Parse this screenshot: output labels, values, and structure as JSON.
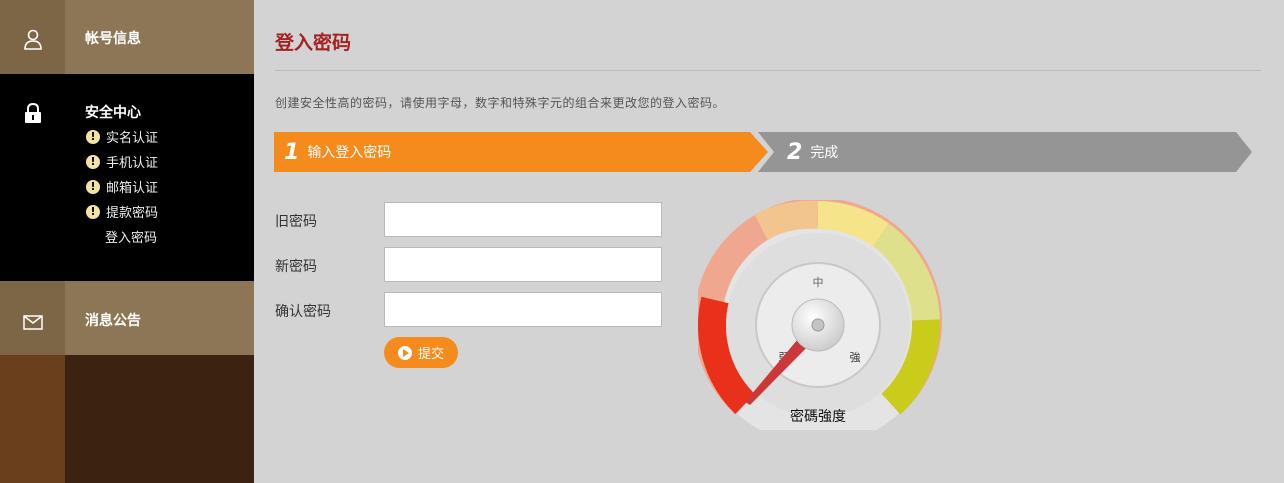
{
  "sidebar": {
    "account": {
      "title": "帐号信息",
      "icon": "user-icon"
    },
    "security": {
      "title": "安全中心",
      "icon": "lock-icon",
      "items": [
        {
          "label": "实名认证",
          "warning": true
        },
        {
          "label": "手机认证",
          "warning": true
        },
        {
          "label": "邮箱认证",
          "warning": true
        },
        {
          "label": "提款密码",
          "warning": true
        },
        {
          "label": "登入密码",
          "warning": false
        }
      ]
    },
    "notices": {
      "title": "消息公告",
      "icon": "mail-icon"
    }
  },
  "main": {
    "title": "登入密码",
    "description": "创建安全性高的密码，请使用字母，数字和特殊字元的组合来更改您的登入密码。",
    "steps": [
      {
        "number": "1",
        "label": "输入登入密码",
        "active": true
      },
      {
        "number": "2",
        "label": "完成",
        "active": false
      }
    ],
    "form": {
      "old_password_label": "旧密码",
      "new_password_label": "新密码",
      "confirm_password_label": "确认密码",
      "submit_label": "提交"
    },
    "gauge": {
      "caption": "密碼強度",
      "label_weak": "弱",
      "label_mid": "中",
      "label_strong": "強",
      "level": 0
    }
  },
  "colors": {
    "accent_orange": "#f58a1d",
    "title_red": "#a32323",
    "step_inactive": "#999999"
  }
}
